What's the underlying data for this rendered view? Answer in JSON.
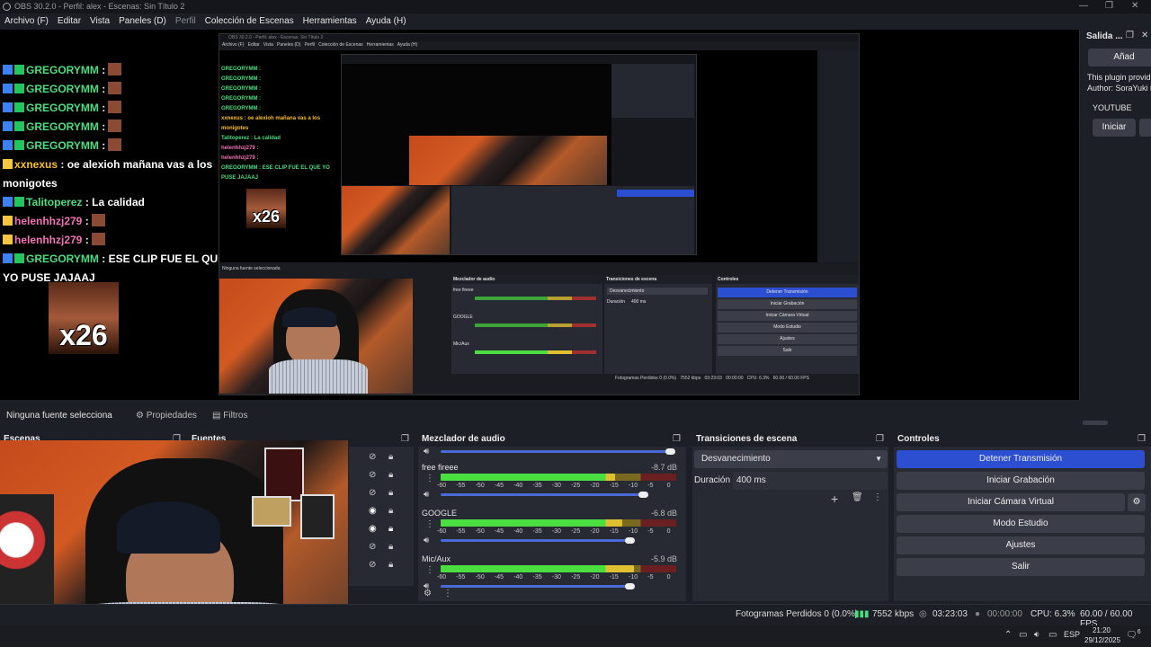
{
  "window": {
    "title": "OBS 30.2.0 - Perfil: alex - Escenas: Sin Título 2"
  },
  "menu": [
    "Archivo (F)",
    "Editar",
    "Vista",
    "Paneles (D)",
    "Perfil",
    "Colección de Escenas",
    "Herramientas",
    "Ayuda (H)"
  ],
  "chat": [
    {
      "user": "GREGORYMM",
      "msg": ":",
      "color": "#4ade80",
      "badge": "blue"
    },
    {
      "user": "GREGORYMM",
      "msg": ":",
      "color": "#4ade80",
      "badge": "blue"
    },
    {
      "user": "GREGORYMM",
      "msg": ":",
      "color": "#4ade80",
      "badge": "blue"
    },
    {
      "user": "GREGORYMM",
      "msg": ":",
      "color": "#4ade80",
      "badge": "blue"
    },
    {
      "user": "GREGORYMM",
      "msg": ":",
      "color": "#4ade80",
      "badge": "blue"
    },
    {
      "user": "xxnexus",
      "msg": ": oe alexioh mañana vas a los",
      "color": "#fbbf24",
      "badge": "gold"
    },
    {
      "user": "",
      "msg": "monigotes",
      "color": "#ffffff",
      "badge": "none"
    },
    {
      "user": "Talitoperez",
      "msg": ": La calidad",
      "color": "#4ade80",
      "badge": "blue"
    },
    {
      "user": "helenhhzj279",
      "msg": ":",
      "color": "#f472b6",
      "badge": "gold"
    },
    {
      "user": "helenhhzj279",
      "msg": ":",
      "color": "#f472b6",
      "badge": "gold"
    },
    {
      "user": "GREGORYMM",
      "msg": ": ESE CLIP FUE EL QUE",
      "color": "#4ade80",
      "badge": "blue"
    },
    {
      "user": "",
      "msg": "YO PUSE JAJAAJ",
      "color": "#ffffff",
      "badge": "none"
    }
  ],
  "emote_label": "x26",
  "salida": {
    "title": "Salida ...",
    "add_button": "Añad",
    "desc1": "This plugin provid",
    "desc2": "Author: SoraYuki i",
    "platform": "YOUTUBE",
    "start_button": "Iniciar"
  },
  "info": {
    "no_source": "Ninguna fuente selecciona",
    "properties": "Propiedades",
    "filters": "Filtros"
  },
  "docks": {
    "scenes": "Escenas",
    "sources": "Fuentes",
    "mixer": "Mezclador de audio",
    "transitions": "Transiciones de escena",
    "controls": "Controles"
  },
  "mixer": {
    "channels": [
      {
        "name": "free fireee",
        "db": "-8.7 dB",
        "level": 0.74,
        "volume": 0.86
      },
      {
        "name": "GOOGLE",
        "db": "-6.8 dB",
        "level": 0.77,
        "volume": 0.8
      },
      {
        "name": "Mic/Aux",
        "db": "-5.9 dB",
        "level": 0.82,
        "volume": 0.8
      }
    ],
    "scale": [
      "-60",
      "-55",
      "-50",
      "-45",
      "-40",
      "-35",
      "-30",
      "-25",
      "-20",
      "-15",
      "-10",
      "-5",
      "0"
    ]
  },
  "transitions": {
    "selected": "Desvanecimiento",
    "duration_label": "Duración",
    "duration_value": "400 ms"
  },
  "controls": {
    "stop_stream": "Detener Transmisión",
    "start_recording": "Iniciar Grabación",
    "virtual_cam": "Iniciar Cámara Virtual",
    "studio_mode": "Modo Estudio",
    "settings": "Ajustes",
    "exit": "Salir"
  },
  "status": {
    "dropped": "Fotogramas Perdidos 0 (0.0%)",
    "bitrate": "7552 kbps",
    "stream_time": "03:23:03",
    "rec_time": "00:00:00",
    "cpu": "CPU: 6.3%",
    "fps": "60.00 / 60.00 FPS"
  },
  "taskbar": {
    "lang": "ESP",
    "time": "21:20",
    "date": "29/12/2025",
    "notif_count": "6"
  },
  "nested": {
    "title": "OBS 30.2.0 - Perfil: alex - Escenas: Sin Título 2",
    "menu": "Archivo (F)   Editar   Vista   Paneles (D)   Perfil   Colección de Escenas   Herramientas   Ayuda (H)",
    "no_source": "Ninguna fuente seleccionada",
    "mixer": "Mezclador de audio",
    "transitions": "Transiciones de escena",
    "controls": "Controles",
    "stop": "Detener Transmisión",
    "rec": "Iniciar Grabación",
    "vcam": "Iniciar Cámara Virtual",
    "studio": "Modo Estudio",
    "settings": "Ajustes",
    "exit": "Salir",
    "fade": "Desvanecimiento",
    "dur": "Duración",
    "dur_val": "400 ms",
    "status": "Fotogramas Perdidos 0 (0.0%)   7552 kbps   03:23:03   00:00:00   CPU: 6.3%   60.00 / 60.00 FPS",
    "ch1": "free fireee",
    "ch2": "GOOGLE",
    "ch3": "Mic/Aux",
    "chat1": "GREGORYMM :",
    "chat2": "xxnexus : oe alexioh mañana vas a los monigotes",
    "chat3": "Talitoperez : La calidad",
    "chat4": "helenhhzj279 :",
    "chat5": "GREGORYMM : ESE CLIP FUE EL QUE YO PUSE JAJAAJ"
  }
}
